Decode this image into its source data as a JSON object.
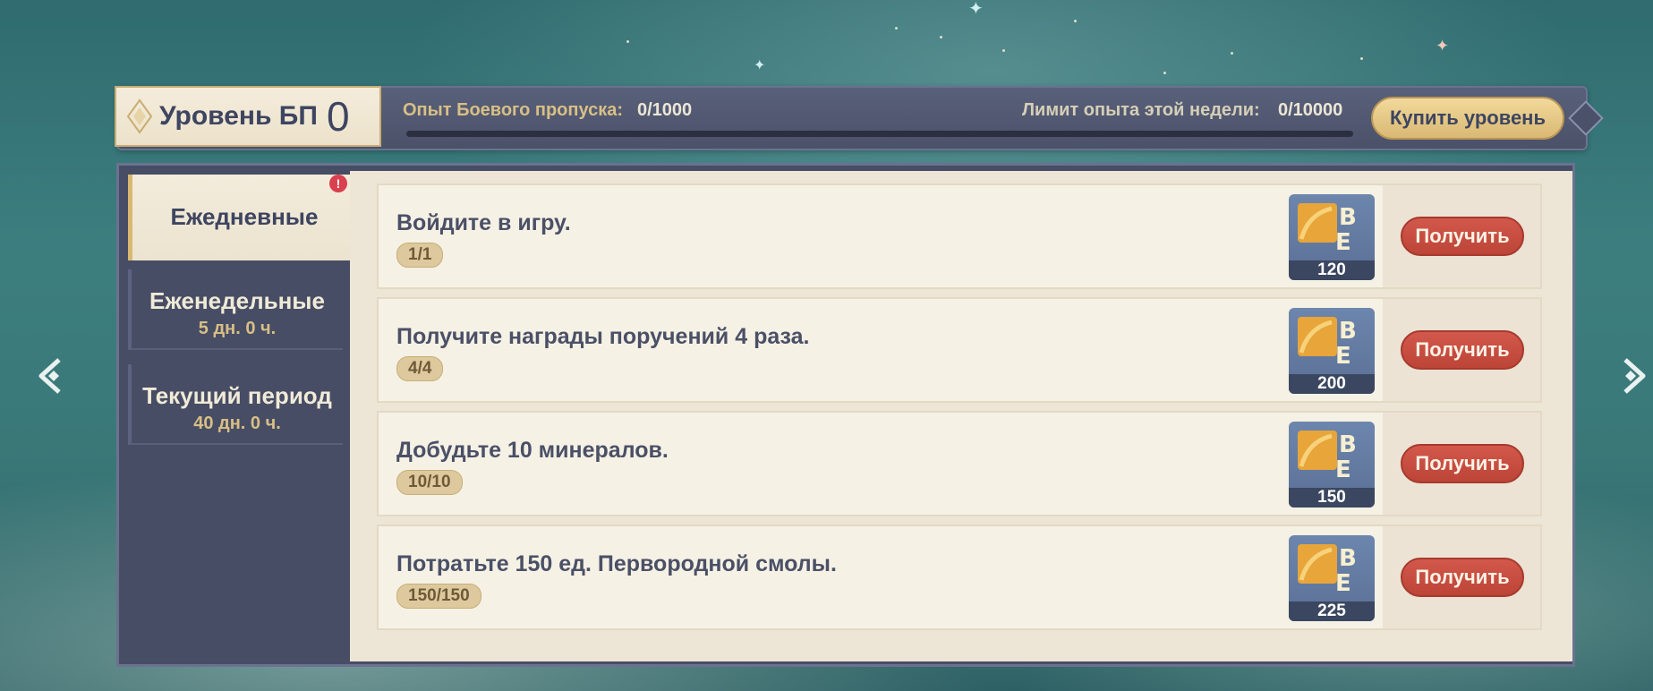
{
  "header": {
    "level_label": "Уровень БП",
    "level_value": "0",
    "exp_label": "Опыт Боевого пропуска:",
    "exp_value": "0/1000",
    "exp_progress": 0,
    "week_label": "Лимит опыта этой недели:",
    "week_value": "0/10000",
    "buy_button": "Купить уровень"
  },
  "tabs": [
    {
      "title": "Ежедневные",
      "sub": ""
    },
    {
      "title": "Еженедельные",
      "sub": "5 дн. 0 ч."
    },
    {
      "title": "Текущий период",
      "sub": "40 дн. 0 ч."
    }
  ],
  "alert_badge": "!",
  "tasks": [
    {
      "title": "Войдите в игру.",
      "progress": "1/1",
      "reward": "120",
      "claim": "Получить"
    },
    {
      "title": "Получите награды поручений 4 раза.",
      "progress": "4/4",
      "reward": "200",
      "claim": "Получить"
    },
    {
      "title": "Добудьте 10 минералов.",
      "progress": "10/10",
      "reward": "150",
      "claim": "Получить"
    },
    {
      "title": "Потратьте 150 ед. Первородной смолы.",
      "progress": "150/150",
      "reward": "225",
      "claim": "Получить"
    }
  ],
  "icons": {
    "reward": "bp-exp-icon",
    "left_nav": "left-arrow-icon",
    "right_nav": "right-arrow-icon"
  },
  "colors": {
    "accent_gold": "#d9b873",
    "claim_red": "#c94d40",
    "panel_dark": "#474d64"
  }
}
